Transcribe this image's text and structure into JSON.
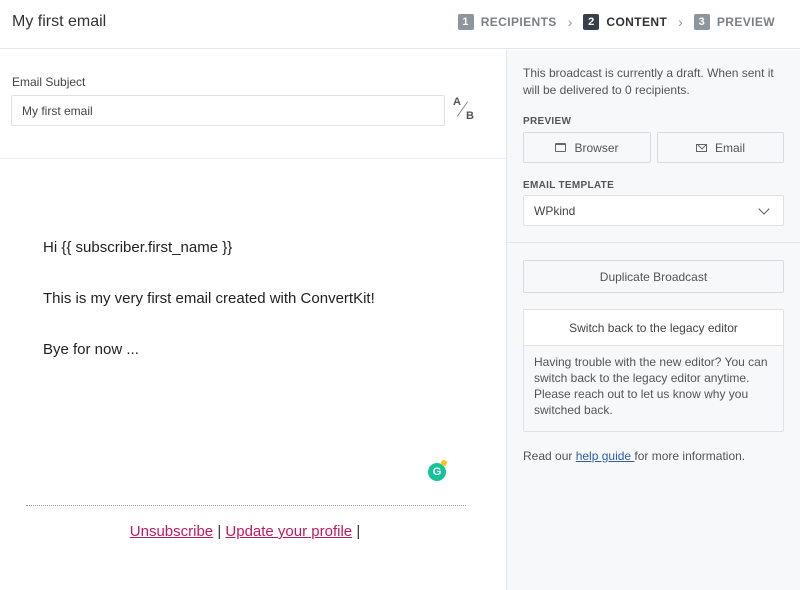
{
  "header": {
    "title": "My first email",
    "steps": [
      {
        "num": "1",
        "label": "RECIPIENTS"
      },
      {
        "num": "2",
        "label": "CONTENT"
      },
      {
        "num": "3",
        "label": "PREVIEW"
      }
    ],
    "active_step": "2"
  },
  "subject": {
    "label": "Email Subject",
    "value": "My first email",
    "ab_a": "A",
    "ab_b": "B"
  },
  "email_body": {
    "lines": [
      "Hi {{ subscriber.first_name }}",
      "This is my very first email created with ConvertKit!",
      "Bye for now ..."
    ],
    "unsubscribe": "Unsubscribe",
    "update_profile": "Update your profile",
    "separator": "|"
  },
  "sidebar": {
    "draft_note": "This broadcast is currently a draft. When sent it will be delivered to 0 recipients.",
    "preview_label": "PREVIEW",
    "browser_button": "Browser",
    "email_button": "Email",
    "template_label": "EMAIL TEMPLATE",
    "template_value": "WPkind",
    "duplicate_button": "Duplicate Broadcast",
    "legacy_button": "Switch back to the legacy editor",
    "legacy_text": "Having trouble with the new editor? You can switch back to the legacy editor anytime. Please reach out to let us know why you switched back.",
    "help_prefix": "Read our ",
    "help_link": "help guide ",
    "help_suffix": "for more information."
  },
  "colors": {
    "link_pink": "#c2185b",
    "help_link_blue": "#2f5da8",
    "grammarly_green": "#15c39a"
  }
}
